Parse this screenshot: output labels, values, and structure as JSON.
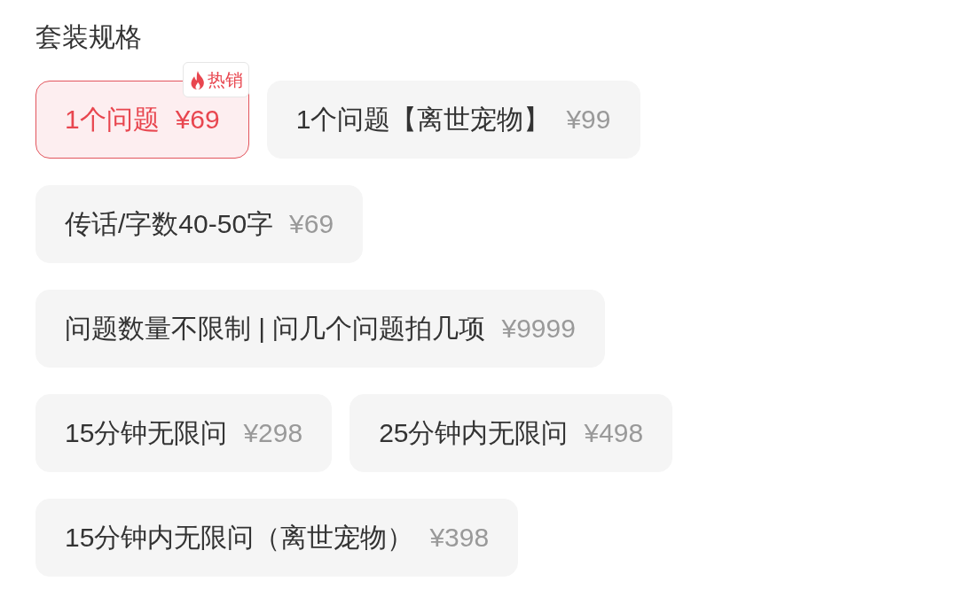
{
  "section": {
    "title": "套装规格"
  },
  "options": [
    {
      "name": "1个问题",
      "price": "¥69",
      "selected": true,
      "badge": "热销"
    },
    {
      "name": "1个问题【离世宠物】",
      "price": "¥99",
      "selected": false
    },
    {
      "name": "传话/字数40-50字",
      "price": "¥69",
      "selected": false
    },
    {
      "name": "问题数量不限制 | 问几个问题拍几项",
      "price": "¥9999",
      "selected": false
    },
    {
      "name": "15分钟无限问",
      "price": "¥298",
      "selected": false
    },
    {
      "name": "25分钟内无限问",
      "price": "¥498",
      "selected": false
    },
    {
      "name": "15分钟内无限问（离世宠物）",
      "price": "¥398",
      "selected": false
    }
  ]
}
